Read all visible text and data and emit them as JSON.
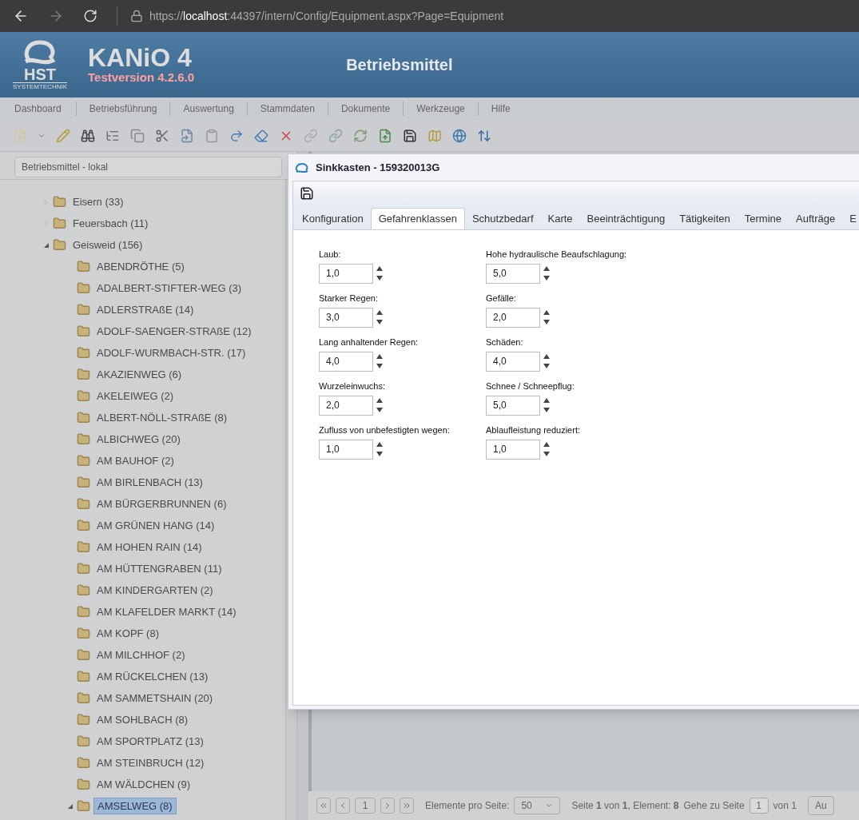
{
  "browser": {
    "url_scheme": "https://",
    "url_host": "localhost",
    "url_rest": ":44397/intern/Config/Equipment.aspx?Page=Equipment"
  },
  "header": {
    "logo_text": "HST",
    "logo_sub": "SYSTEMTECHNIK",
    "app_name": "KANiO 4",
    "version": "Testversion 4.2.6.0",
    "page_title": "Betriebsmittel"
  },
  "menu": [
    "Dashboard",
    "Betriebsführung",
    "Auswertung",
    "Stammdaten",
    "Dokumente",
    "Werkzeuge",
    "Hilfe"
  ],
  "sidebar": {
    "title": "Betriebsmittel - lokal",
    "tree": [
      {
        "label": "Eisern (33)",
        "expanded": false,
        "selected": false
      },
      {
        "label": "Feuersbach (11)",
        "expanded": false,
        "selected": false
      },
      {
        "label": "Geisweid (156)",
        "expanded": true,
        "selected": false,
        "children": [
          {
            "label": "ABENDRÖTHE (5)",
            "selected": false
          },
          {
            "label": "ADALBERT-STIFTER-WEG (3)",
            "selected": false
          },
          {
            "label": "ADLERSTRAßE (14)",
            "selected": false
          },
          {
            "label": "ADOLF-SAENGER-STRAßE (12)",
            "selected": false
          },
          {
            "label": "ADOLF-WURMBACH-STR. (17)",
            "selected": false
          },
          {
            "label": "AKAZIENWEG (6)",
            "selected": false
          },
          {
            "label": "AKELEIWEG (2)",
            "selected": false
          },
          {
            "label": "ALBERT-NÖLL-STRAßE (8)",
            "selected": false
          },
          {
            "label": "ALBICHWEG (20)",
            "selected": false
          },
          {
            "label": "AM BAUHOF (2)",
            "selected": false
          },
          {
            "label": "AM BIRLENBACH (13)",
            "selected": false
          },
          {
            "label": "AM BÜRGERBRUNNEN (6)",
            "selected": false
          },
          {
            "label": "AM GRÜNEN HANG (14)",
            "selected": false
          },
          {
            "label": "AM HOHEN RAIN (14)",
            "selected": false
          },
          {
            "label": "AM HÜTTENGRABEN (11)",
            "selected": false
          },
          {
            "label": "AM KINDERGARTEN (2)",
            "selected": false
          },
          {
            "label": "AM KLAFELDER MARKT (14)",
            "selected": false
          },
          {
            "label": "AM KOPF (8)",
            "selected": false
          },
          {
            "label": "AM MILCHHOF (2)",
            "selected": false
          },
          {
            "label": "AM RÜCKELCHEN (13)",
            "selected": false
          },
          {
            "label": "AM SAMMETSHAIN (20)",
            "selected": false
          },
          {
            "label": "AM SOHLBACH (8)",
            "selected": false
          },
          {
            "label": "AM SPORTPLATZ (13)",
            "selected": false
          },
          {
            "label": "AM STEINBRUCH (12)",
            "selected": false
          },
          {
            "label": "AM WÄLDCHEN (9)",
            "selected": false
          },
          {
            "label": "AMSELWEG (8)",
            "selected": true,
            "expanded": true
          }
        ]
      }
    ]
  },
  "dialog": {
    "title": "Sinkkasten - 159320013G",
    "tabs": [
      {
        "label": "Konfiguration",
        "selected": false
      },
      {
        "label": "Gefahrenklassen",
        "selected": true
      },
      {
        "label": "Schutzbedarf",
        "selected": false
      },
      {
        "label": "Karte",
        "selected": false
      },
      {
        "label": "Beeinträchtigung",
        "selected": false
      },
      {
        "label": "Tätigkeiten",
        "selected": false
      },
      {
        "label": "Termine",
        "selected": false
      },
      {
        "label": "Aufträge",
        "selected": false
      },
      {
        "label": "E",
        "selected": false
      }
    ],
    "columns": [
      [
        {
          "label": "Laub:",
          "value": "1,0"
        },
        {
          "label": "Starker Regen:",
          "value": "3,0"
        },
        {
          "label": "Lang anhaltender Regen:",
          "value": "4,0"
        },
        {
          "label": "Wurzeleinwuchs:",
          "value": "2,0"
        },
        {
          "label": "Zufluss von unbefestigten wegen:",
          "value": "1,0"
        }
      ],
      [
        {
          "label": "Hohe hydraulische Beaufschlagung:",
          "value": "5,0"
        },
        {
          "label": "Gefälle:",
          "value": "2,0"
        },
        {
          "label": "Schäden:",
          "value": "4,0"
        },
        {
          "label": "Schnee / Schneepflug:",
          "value": "5,0"
        },
        {
          "label": "Ablaufleistung reduziert:",
          "value": "1,0"
        }
      ]
    ]
  },
  "pager": {
    "page": "1",
    "per_page_label": "Elemente pro Seite:",
    "per_page": "50",
    "info": "Seite **1** von **1**, Element: **8**",
    "goto_label": "Gehe zu Seite",
    "goto_value": "1",
    "goto_of": "von 1",
    "button": "Au"
  }
}
